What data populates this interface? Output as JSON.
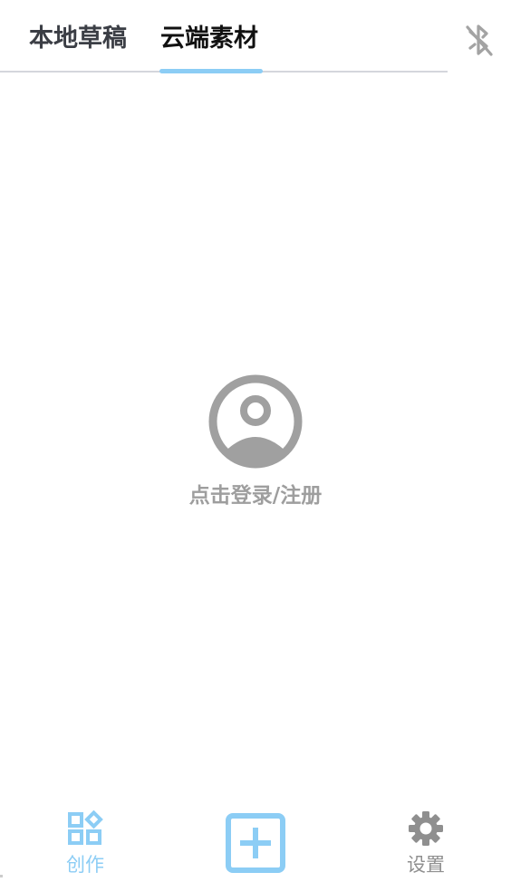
{
  "tabs": {
    "local_label": "本地草稿",
    "cloud_label": "云端素材",
    "active": "cloud"
  },
  "header": {
    "bluetooth_icon": "bluetooth-off-icon"
  },
  "login": {
    "icon": "user-circle-icon",
    "label": "点击登录/注册"
  },
  "bottom_nav": {
    "create": {
      "label": "创作",
      "icon": "apps-grid-icon",
      "active": true
    },
    "add": {
      "icon": "plus-square-icon"
    },
    "settings": {
      "label": "设置",
      "icon": "gear-icon",
      "active": false
    }
  },
  "colors": {
    "accent": "#8ccdf5",
    "inactive_icon": "#8f8f8f",
    "muted_text": "#9e9e9e",
    "tab_text": "#3b3e45"
  }
}
